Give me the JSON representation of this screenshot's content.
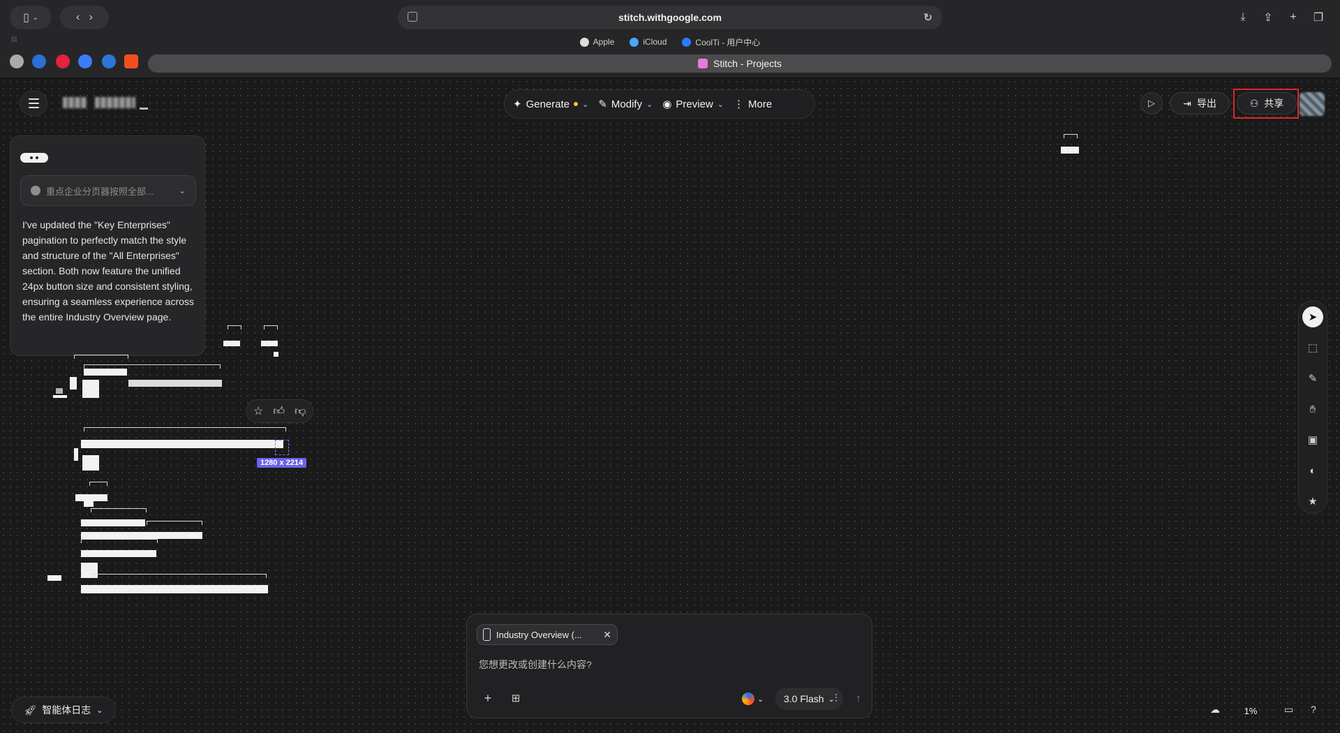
{
  "browser": {
    "url": "stitch.withgoogle.com",
    "favorites": [
      {
        "label": "Apple",
        "color": "#dddddd"
      },
      {
        "label": "iCloud",
        "color": "#4aa6ff"
      },
      {
        "label": "CoolTi - 用户中心",
        "color": "#2a7cff"
      }
    ],
    "active_tab": "Stitch - Projects"
  },
  "app": {
    "center_toolbar": {
      "generate": "Generate",
      "modify": "Modify",
      "preview": "Preview",
      "more": "More"
    },
    "export_label": "导出",
    "share_label": "共享"
  },
  "chat": {
    "version_placeholder": "重点企业分页器按照全部...",
    "message": "I've updated the \"Key Enterprises\" pagination to perfectly match the style and structure of the \"All Enterprises\" section. Both now feature the unified 24px button size and consistent styling, ensuring a seamless experience across the entire Industry Overview page."
  },
  "canvas": {
    "selection_size": "1280 x 2214"
  },
  "composer": {
    "context_chip": "Industry Overview (...",
    "placeholder": "您想更改或创建什么内容?",
    "model": "3.0 Flash"
  },
  "footer": {
    "agent_log": "智能体日志",
    "zoom": "1%"
  },
  "colors": {
    "accent": "#6d62e8",
    "share_highlight": "#e0242b"
  }
}
